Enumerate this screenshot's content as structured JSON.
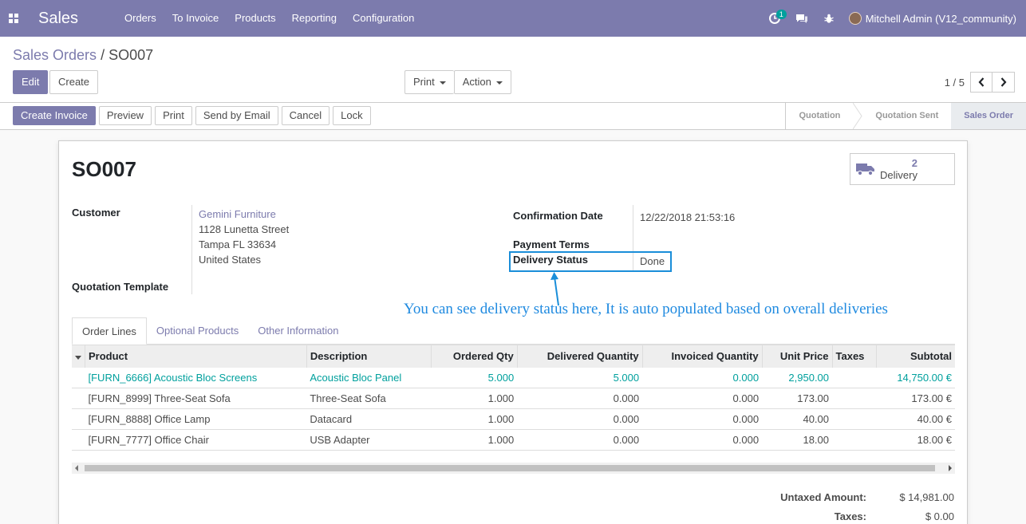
{
  "navbar": {
    "brand": "Sales",
    "menu": [
      "Orders",
      "To Invoice",
      "Products",
      "Reporting",
      "Configuration"
    ],
    "activity_badge": "1",
    "user": "Mitchell Admin (V12_community)"
  },
  "breadcrumb": {
    "parent": "Sales Orders",
    "separator": "/",
    "current": "SO007"
  },
  "buttons": {
    "edit": "Edit",
    "create": "Create",
    "print": "Print",
    "action": "Action"
  },
  "pager": {
    "value": "1 / 5"
  },
  "status_buttons": [
    "Create Invoice",
    "Preview",
    "Print",
    "Send by Email",
    "Cancel",
    "Lock"
  ],
  "stages": [
    {
      "label": "Quotation",
      "active": false
    },
    {
      "label": "Quotation Sent",
      "active": false
    },
    {
      "label": "Sales Order",
      "active": true
    }
  ],
  "form": {
    "title": "SO007",
    "smart_button": {
      "count": "2",
      "label": "Delivery"
    },
    "customer_label": "Customer",
    "customer_name": "Gemini Furniture",
    "customer_address": [
      "1128 Lunetta Street",
      "Tampa FL 33634",
      "United States"
    ],
    "quotation_template_label": "Quotation Template",
    "confirmation_date_label": "Confirmation Date",
    "confirmation_date": "12/22/2018 21:53:16",
    "payment_terms_label": "Payment Terms",
    "delivery_status_label": "Delivery Status",
    "delivery_status": "Done"
  },
  "annotation": "You can see delivery status here, It is auto populated based on overall deliveries",
  "tabs": [
    {
      "label": "Order Lines",
      "active": true
    },
    {
      "label": "Optional Products",
      "active": false
    },
    {
      "label": "Other Information",
      "active": false
    }
  ],
  "table": {
    "headers": [
      "Product",
      "Description",
      "Ordered Qty",
      "Delivered Quantity",
      "Invoiced Quantity",
      "Unit Price",
      "Taxes",
      "Subtotal"
    ],
    "rows": [
      [
        "[FURN_6666] Acoustic Bloc Screens",
        "Acoustic Bloc Panel",
        "5.000",
        "5.000",
        "0.000",
        "2,950.00",
        "",
        "14,750.00 €"
      ],
      [
        "[FURN_8999] Three-Seat Sofa",
        "Three-Seat Sofa",
        "1.000",
        "0.000",
        "0.000",
        "173.00",
        "",
        "173.00 €"
      ],
      [
        "[FURN_8888] Office Lamp",
        "Datacard",
        "1.000",
        "0.000",
        "0.000",
        "40.00",
        "",
        "40.00 €"
      ],
      [
        "[FURN_7777] Office Chair",
        "USB Adapter",
        "1.000",
        "0.000",
        "0.000",
        "18.00",
        "",
        "18.00 €"
      ]
    ]
  },
  "totals": {
    "untaxed_label": "Untaxed Amount:",
    "untaxed_value": "$ 14,981.00",
    "taxes_label": "Taxes:",
    "taxes_value": "$ 0.00"
  },
  "colors": {
    "brand": "#7c7bad",
    "link": "#00a09d",
    "annotation": "#1f8ae0"
  }
}
